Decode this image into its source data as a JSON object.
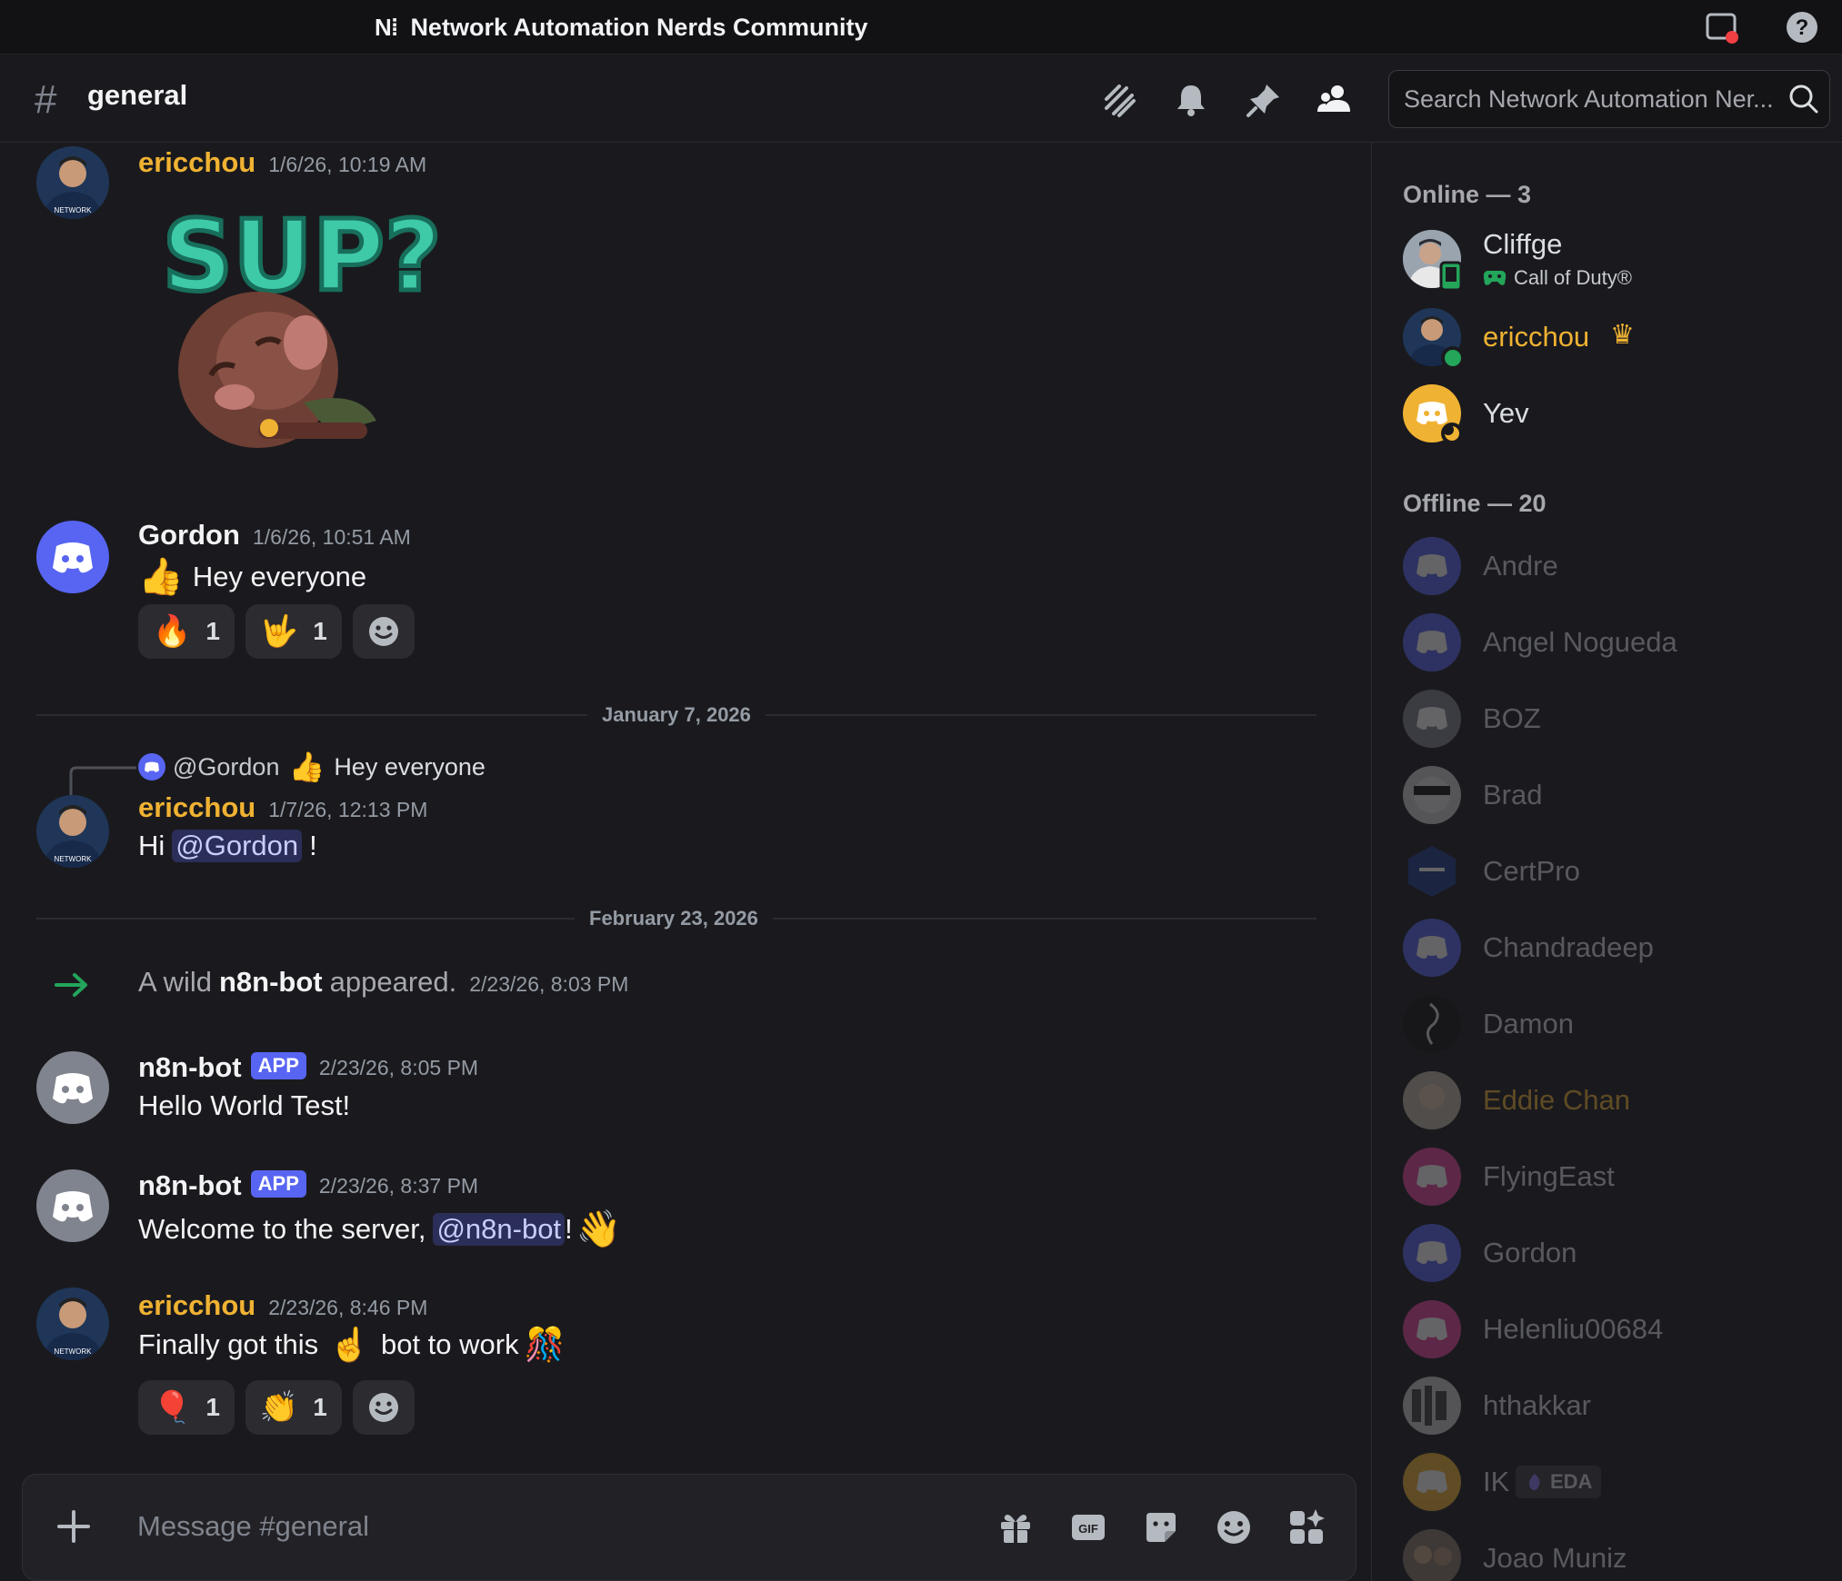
{
  "server": {
    "name": "Network Automation Nerds Community",
    "logo": "N⁞"
  },
  "channel": {
    "name": "general",
    "hash": "#"
  },
  "search": {
    "placeholder": "Search Network Automation Ner..."
  },
  "messages": [
    {
      "author": "ericchou",
      "time": "1/6/26, 10:19 AM",
      "sticker_text": "SUP?"
    },
    {
      "author": "Gordon",
      "time": "1/6/26, 10:51 AM",
      "text": "Hey everyone",
      "emoji": "👍",
      "reactions": [
        {
          "emoji": "🔥",
          "count": "1"
        },
        {
          "emoji": "🤟",
          "count": "1"
        }
      ]
    },
    {
      "reply": {
        "mention": "@Gordon",
        "emoji": "👍",
        "text": "Hey everyone"
      },
      "author": "ericchou",
      "time": "1/7/26, 12:13 PM",
      "text_pre": "Hi",
      "mention": "@Gordon",
      "text_post": "!"
    },
    {
      "system_pre": "A wild",
      "system_bot": "n8n-bot",
      "system_post": "appeared.",
      "time": "2/23/26, 8:03 PM"
    },
    {
      "author": "n8n-bot",
      "badge": "APP",
      "time": "2/23/26, 8:05 PM",
      "text": "Hello World Test!"
    },
    {
      "author": "n8n-bot",
      "badge": "APP",
      "time": "2/23/26, 8:37 PM",
      "text_pre": "Welcome to the server,",
      "mention": "@n8n-bot",
      "text_post": "!",
      "emoji": "👋"
    },
    {
      "author": "ericchou",
      "time": "2/23/26, 8:46 PM",
      "text_pre": "Finally got this",
      "emoji1": "☝️",
      "text_post": "bot to work",
      "emoji2": "🎊",
      "reactions": [
        {
          "emoji": "🎈",
          "count": "1"
        },
        {
          "emoji": "👏",
          "count": "1"
        }
      ]
    }
  ],
  "dividers": [
    "January 7, 2026",
    "February 23, 2026"
  ],
  "composer": {
    "placeholder": "Message #general"
  },
  "members": {
    "online_header": "Online — 3",
    "offline_header": "Offline — 20",
    "online": [
      {
        "name": "Cliffge",
        "activity": "Call of Duty®"
      },
      {
        "name": "ericchou",
        "crown": "♛"
      },
      {
        "name": "Yev"
      }
    ],
    "offline": [
      {
        "name": "Andre"
      },
      {
        "name": "Angel Nogueda"
      },
      {
        "name": "BOZ"
      },
      {
        "name": "Brad"
      },
      {
        "name": "CertPro"
      },
      {
        "name": "Chandradeep"
      },
      {
        "name": "Damon"
      },
      {
        "name": "Eddie Chan"
      },
      {
        "name": "FlyingEast"
      },
      {
        "name": "Gordon"
      },
      {
        "name": "Helenliu00684"
      },
      {
        "name": "hthakkar"
      },
      {
        "name": "IK",
        "tag": "EDA"
      },
      {
        "name": "Joao Muniz"
      }
    ]
  },
  "colors": {
    "blurple": "#5865f2",
    "online": "#23a55a",
    "idle": "#f0b232",
    "owner": "#f0b232",
    "arrow": "#23a55a"
  }
}
